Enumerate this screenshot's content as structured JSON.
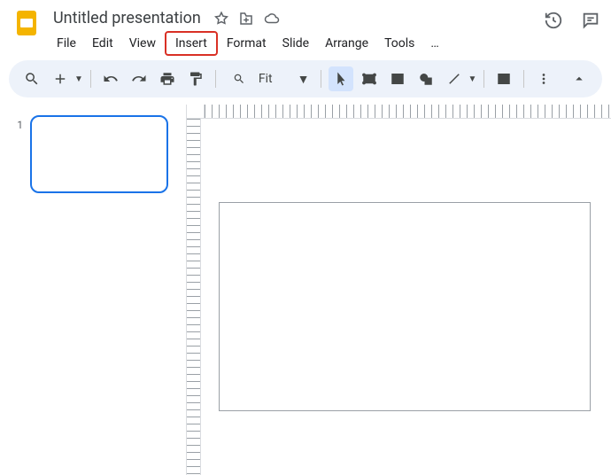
{
  "doc": {
    "title": "Untitled presentation"
  },
  "menu": {
    "items": [
      "File",
      "Edit",
      "View",
      "Insert",
      "Format",
      "Slide",
      "Arrange",
      "Tools"
    ],
    "more": "…",
    "highlighted_index": 3
  },
  "toolbar": {
    "zoom_label": "Fit"
  },
  "thumbs": {
    "slides": [
      {
        "number": "1"
      }
    ]
  }
}
